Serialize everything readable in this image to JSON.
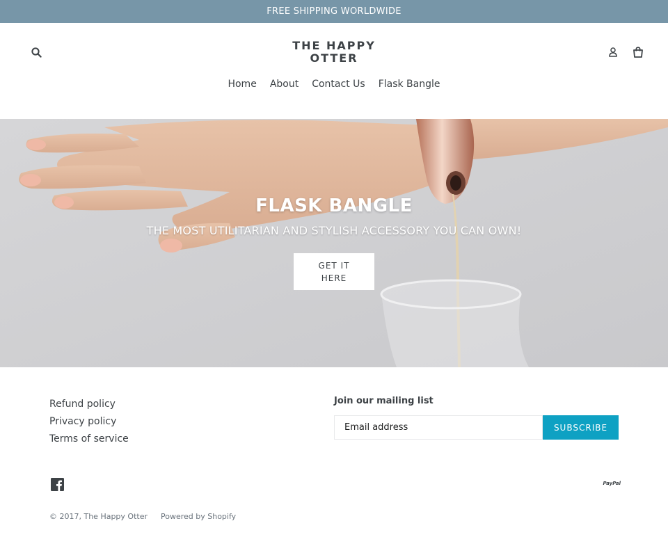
{
  "announcement": {
    "text": "FREE SHIPPING WORLDWIDE"
  },
  "header": {
    "logo_line1": "THE HAPPY",
    "logo_line2": "OTTER",
    "nav": [
      {
        "label": "Home"
      },
      {
        "label": "About"
      },
      {
        "label": "Contact Us"
      },
      {
        "label": "Flask Bangle"
      }
    ],
    "icons": {
      "search": "search-icon",
      "account": "account-icon",
      "cart": "cart-icon"
    }
  },
  "hero": {
    "title": "FLASK BANGLE",
    "subtitle": "THE MOST UTILITARIAN AND STYLISH ACCESSORY YOU CAN OWN!",
    "button_label": "GET IT HERE"
  },
  "footer": {
    "links": [
      {
        "label": "Refund policy"
      },
      {
        "label": "Privacy policy"
      },
      {
        "label": "Terms of service"
      }
    ],
    "mailing": {
      "title": "Join our mailing list",
      "placeholder": "Email address",
      "button_label": "SUBSCRIBE"
    },
    "social_icon": "facebook-icon",
    "payment": "PayPal",
    "copyright": "© 2017, The Happy Otter",
    "powered_by": "Powered by Shopify"
  },
  "colors": {
    "announcement_bg": "#7796a8",
    "subscribe_bg": "#0ea1c3",
    "text": "#3d4246"
  }
}
